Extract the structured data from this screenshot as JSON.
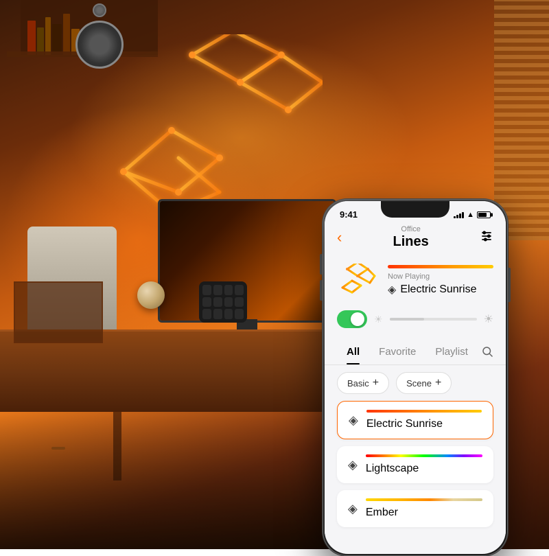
{
  "scene": {
    "background": "#3a1a08",
    "room": "Office"
  },
  "phone": {
    "status_bar": {
      "time": "9:41",
      "signal": 4,
      "battery_pct": 75
    },
    "header": {
      "back_label": "‹",
      "subtitle": "Office",
      "title": "Lines",
      "settings_icon": "⚙"
    },
    "now_playing": {
      "label": "Now Playing",
      "scene_name": "Electric Sunrise",
      "drop_icon": "◈"
    },
    "controls": {
      "toggle_on": true,
      "brightness_sun_icon": "☀",
      "brightness_pct": 40
    },
    "tabs": [
      {
        "label": "All",
        "active": true
      },
      {
        "label": "Favorite",
        "active": false
      },
      {
        "label": "Playlist",
        "active": false
      }
    ],
    "search_icon": "🔍",
    "filters": [
      {
        "label": "Basic",
        "plus": "+"
      },
      {
        "label": "Scene",
        "plus": "+"
      }
    ],
    "scenes": [
      {
        "name": "Electric Sunrise",
        "bar_gradient": "linear-gradient(90deg, #ff3300 0%, #ff6600 30%, #ff9900 60%, #ffcc00 100%)",
        "drop_icon": "◈",
        "active": true
      },
      {
        "name": "Lightscape",
        "bar_gradient": "linear-gradient(90deg, #ff0000 0%, #ff7700 15%, #ffff00 30%, #00ff00 50%, #0088ff 70%, #8800ff 85%, #ff00ff 100%)",
        "drop_icon": "◈",
        "active": false
      },
      {
        "name": "Ember",
        "bar_gradient": "linear-gradient(90deg, #ffd700 0%, #ffb300 30%, #ff8800 60%, #e8d5a0 80%, #d4c88a 100%)",
        "drop_icon": "◈",
        "active": false
      }
    ]
  }
}
